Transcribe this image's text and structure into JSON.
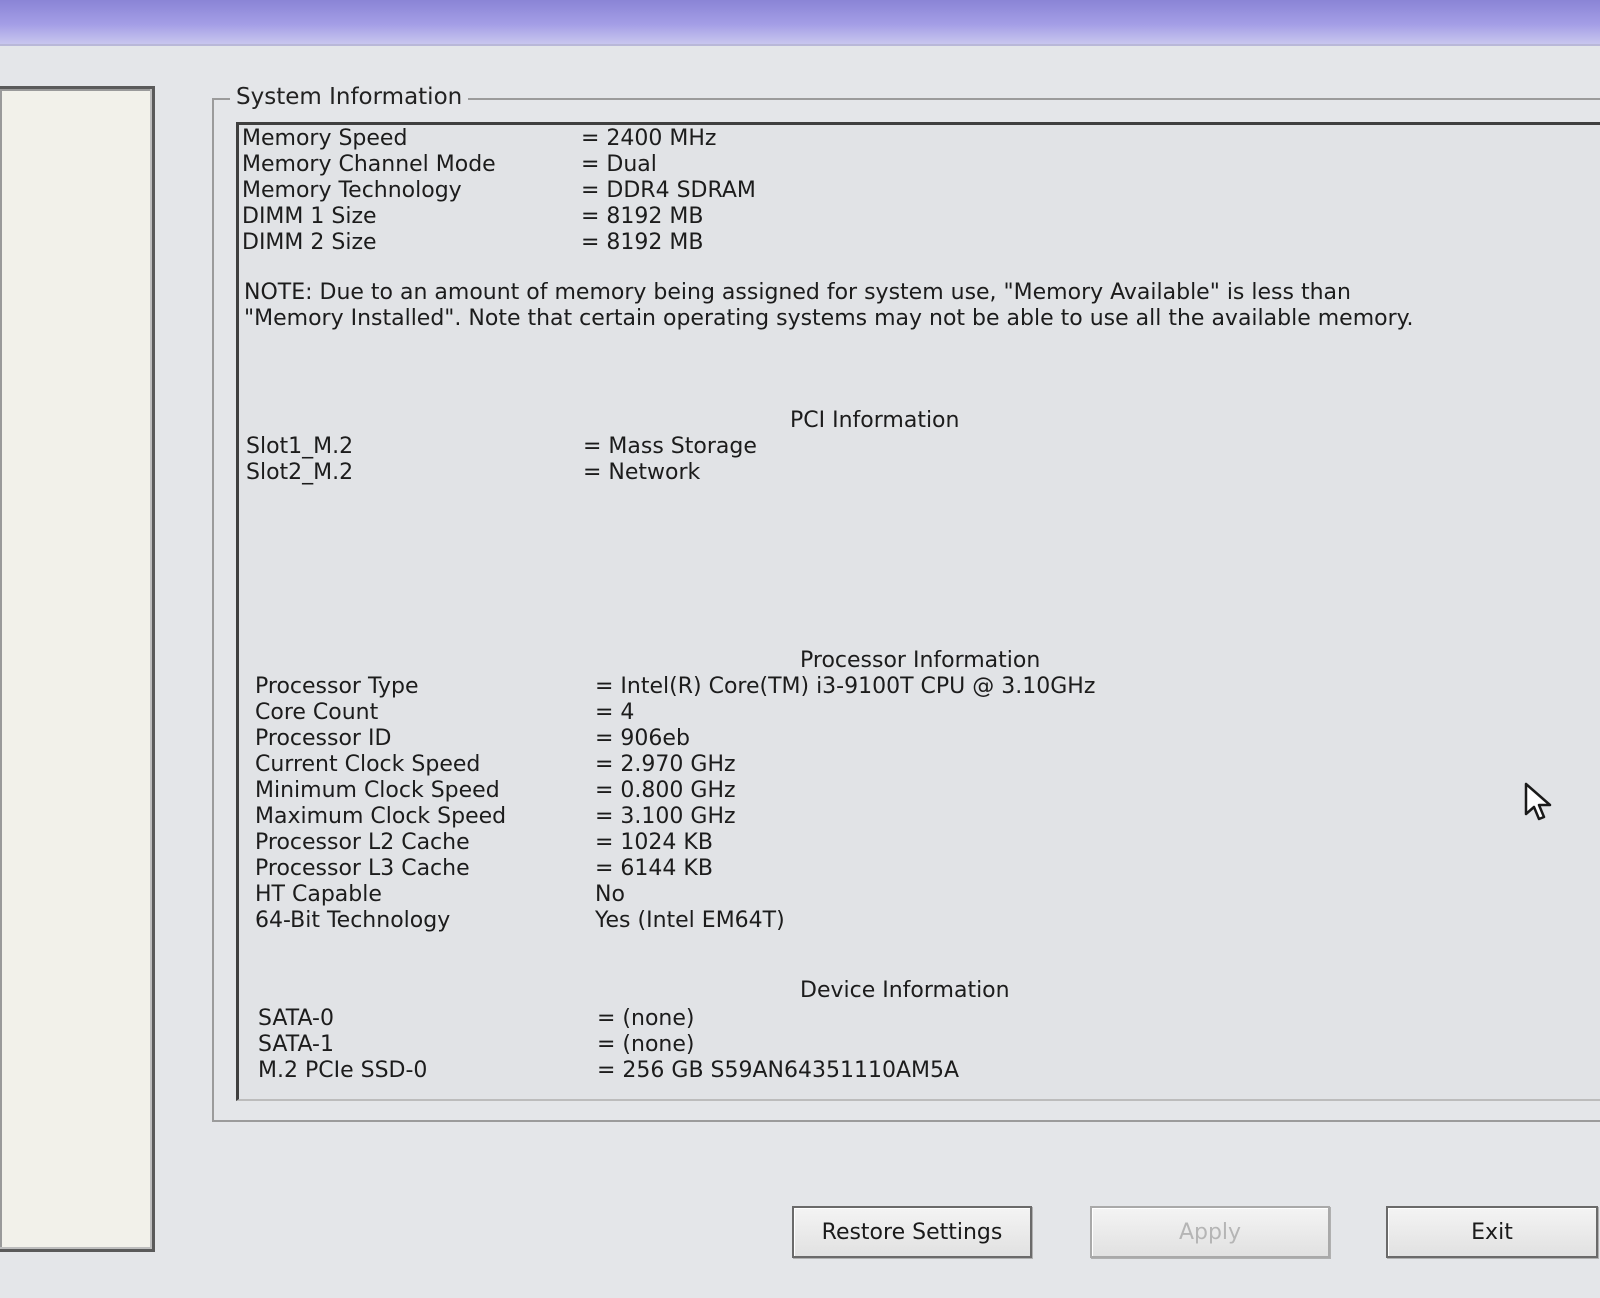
{
  "group_title": "System Information",
  "memory_rows": [
    {
      "label": "Memory Speed",
      "value": "= 2400 MHz"
    },
    {
      "label": "Memory Channel Mode",
      "value": "= Dual"
    },
    {
      "label": "Memory Technology",
      "value": "= DDR4 SDRAM"
    },
    {
      "label": "DIMM 1 Size",
      "value": "= 8192 MB"
    },
    {
      "label": "DIMM 2 Size",
      "value": "= 8192 MB"
    }
  ],
  "note": "NOTE: Due to an amount of memory being assigned for system use, \"Memory Available\" is less than \"Memory Installed\". Note that certain operating systems may not be able to use all the available memory.",
  "pci_heading": "PCI Information",
  "pci_rows": [
    {
      "label": "Slot1_M.2",
      "value": "= Mass Storage"
    },
    {
      "label": "Slot2_M.2",
      "value": "= Network"
    }
  ],
  "processor_heading": "Processor Information",
  "processor_rows": [
    {
      "label": "Processor Type",
      "value": "= Intel(R) Core(TM) i3-9100T CPU @ 3.10GHz"
    },
    {
      "label": "Core Count",
      "value": "= 4"
    },
    {
      "label": "Processor ID",
      "value": "= 906eb"
    },
    {
      "label": "Current Clock Speed",
      "value": "= 2.970 GHz"
    },
    {
      "label": "Minimum Clock Speed",
      "value": "= 0.800 GHz"
    },
    {
      "label": "Maximum Clock Speed",
      "value": "= 3.100 GHz"
    },
    {
      "label": "Processor L2 Cache",
      "value": "= 1024 KB"
    },
    {
      "label": "Processor L3 Cache",
      "value": "= 6144 KB"
    },
    {
      "label": "HT Capable",
      "value": "No"
    },
    {
      "label": "64-Bit Technology",
      "value": "Yes (Intel EM64T)"
    }
  ],
  "device_heading": "Device Information",
  "device_rows": [
    {
      "label": "SATA-0",
      "value": "= (none)"
    },
    {
      "label": "SATA-1",
      "value": "= (none)"
    },
    {
      "label": "M.2 PCIe SSD-0",
      "value": "= 256 GB S59AN64351110AM5A"
    }
  ],
  "buttons": {
    "restore": "Restore Settings",
    "apply": "Apply",
    "exit": "Exit"
  },
  "icons": {
    "cursor": "mouse-pointer-icon"
  }
}
